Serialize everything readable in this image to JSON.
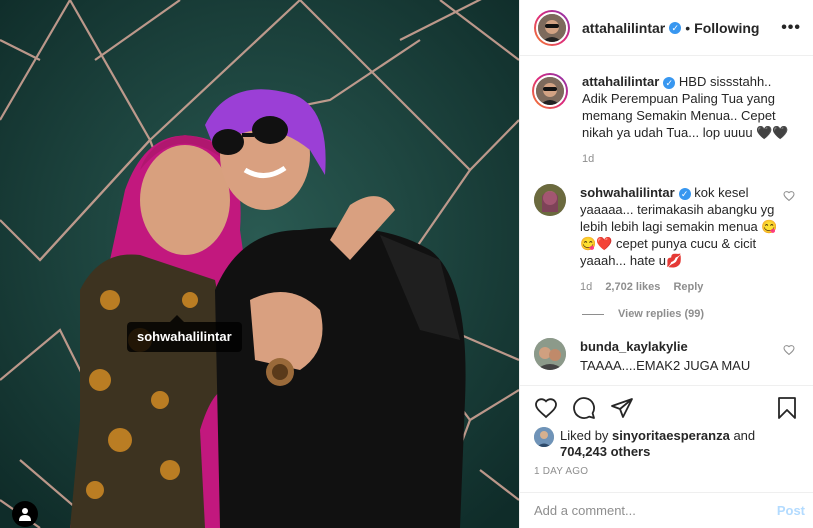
{
  "photo": {
    "tag_label": "sohwahalilintar"
  },
  "header": {
    "username": "attahalilintar",
    "separator": "•",
    "follow_status": "Following",
    "more_label": "•••"
  },
  "caption": {
    "username": "attahalilintar",
    "text": "HBD sissstahh.. Adik Perempuan Paling Tua yang memang Semakin Menua.. Cepet nikah ya udah Tua... lop uuuu 🖤🖤",
    "age": "1d"
  },
  "comments": [
    {
      "username": "sohwahalilintar",
      "text": "kok kesel yaaaaa... terimakasih abangku yg lebih lebih lagi semakin menua 😋😋❤️ cepet punya cucu & cicit yaaah... hate u💋",
      "age": "1d",
      "likes": "2,702 likes",
      "reply_label": "Reply",
      "view_replies": "View replies (99)"
    },
    {
      "username": "bunda_kaylakylie",
      "text": "TAAAA....EMAK2 JUGA MAU"
    }
  ],
  "likes": {
    "prefix": "Liked by",
    "user": "sinyoritaesperanza",
    "and": "and",
    "others": "704,243 others"
  },
  "timestamp": "1 DAY AGO",
  "add_comment": {
    "placeholder": "Add a comment...",
    "post_label": "Post"
  },
  "icons": {
    "like": "heart-icon",
    "comment": "comment-icon",
    "share": "paper-plane-icon",
    "save": "bookmark-icon",
    "user_tags": "person-icon"
  },
  "colors": {
    "verified": "#3897f0",
    "post_disabled": "#b3dbff",
    "muted": "#8e8e8e",
    "text": "#262626"
  }
}
